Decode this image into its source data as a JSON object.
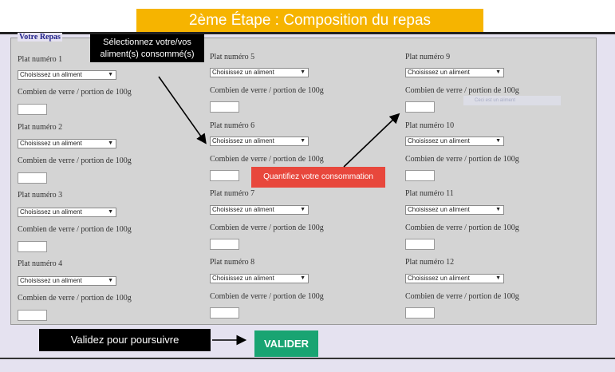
{
  "header": {
    "title": "2ème Étape : Composition du repas"
  },
  "form": {
    "legend": "Votre Repas",
    "select_placeholder": "Choisissez un aliment",
    "qty_label": "Combien de verre / portion de 100g",
    "plats": [
      "Plat numéro 1",
      "Plat numéro 2",
      "Plat numéro 3",
      "Plat numéro 4",
      "Plat numéro 5",
      "Plat numéro 6",
      "Plat numéro 7",
      "Plat numéro 8",
      "Plat numéro 9",
      "Plat numéro 10",
      "Plat numéro 11",
      "Plat numéro 12"
    ],
    "tooltip_text": "Ceci est un aliment"
  },
  "annotations": {
    "select_hint_line1": "Sélectionnez votre/vos",
    "select_hint_line2": "aliment(s) consommé(s)",
    "quantity_hint": "Quantifiez votre consommation",
    "validate_hint": "Validez pour poursuivre"
  },
  "actions": {
    "validate_label": "VALIDER"
  },
  "colors": {
    "title_bg": "#f6b400",
    "validate_bg": "#19a472",
    "quantity_hint_bg": "#e8473c"
  }
}
